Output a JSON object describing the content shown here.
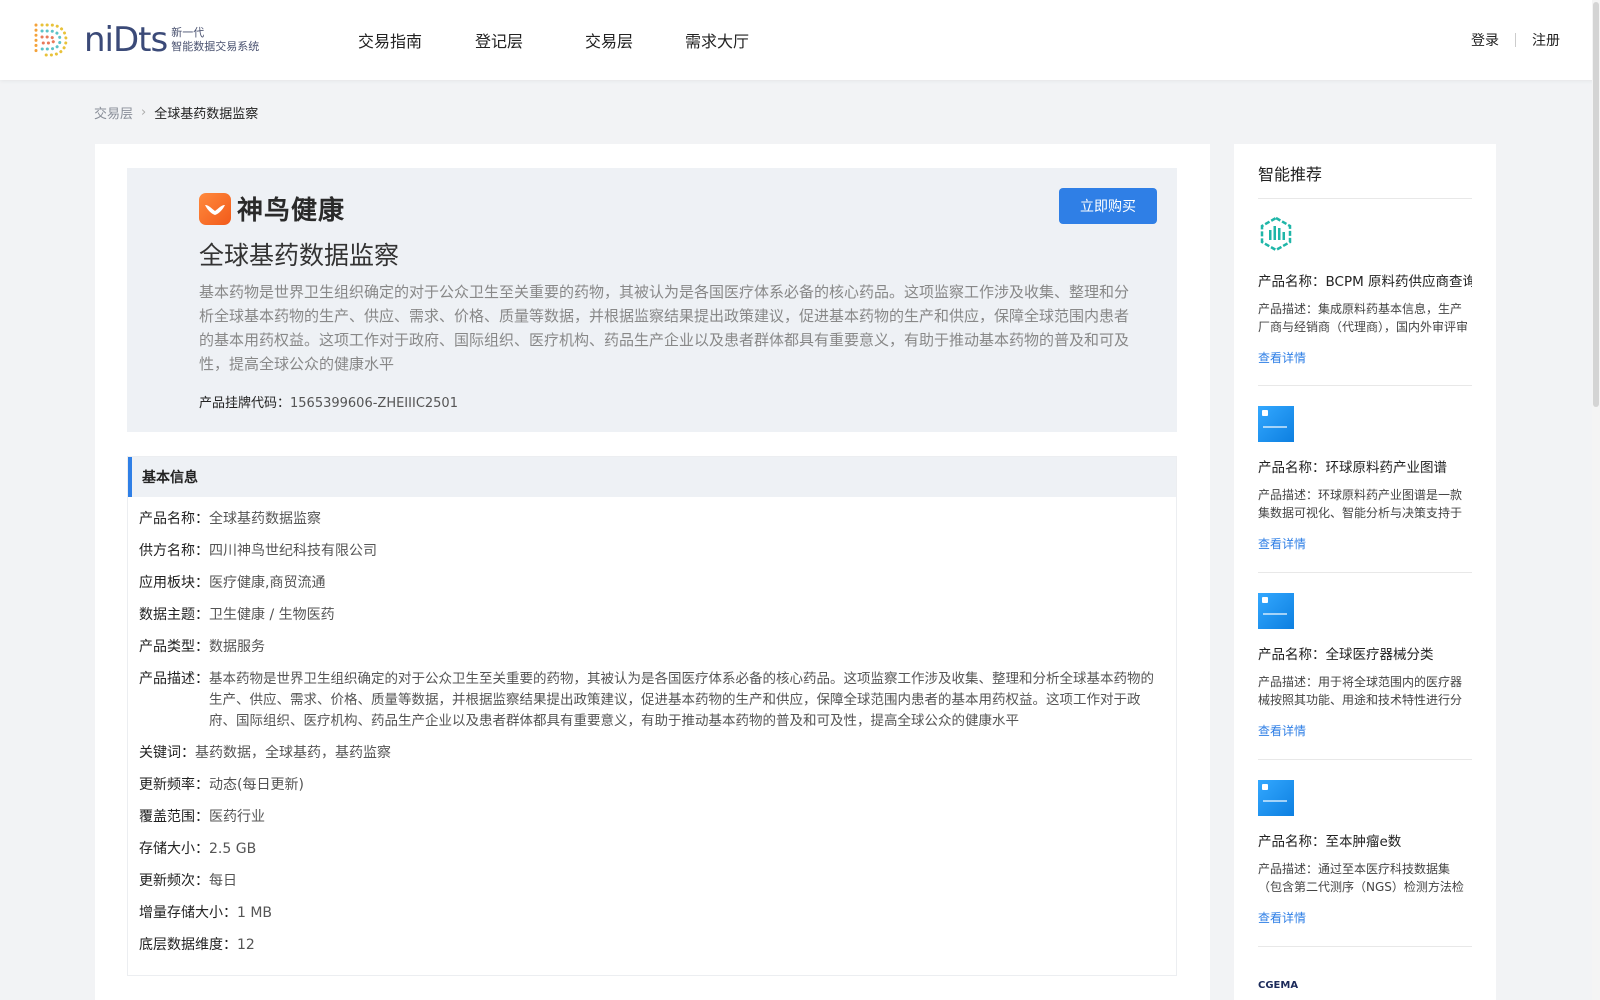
{
  "header": {
    "logo_name": "niDts",
    "logo_sub1": "新一代",
    "logo_sub2": "智能数据交易系统",
    "nav": [
      "交易指南",
      "登记层",
      "交易层",
      "需求大厅"
    ],
    "login": "登录",
    "register": "注册"
  },
  "breadcrumb": {
    "parent": "交易层",
    "sep": "›",
    "current": "全球基药数据监察"
  },
  "hero": {
    "brand": "神鸟健康",
    "buy": "立即购买",
    "title": "全球基药数据监察",
    "desc": "基本药物是世界卫生组织确定的对于公众卫生至关重要的药物，其被认为是各国医疗体系必备的核心药品。这项监察工作涉及收集、整理和分析全球基本药物的生产、供应、需求、价格、质量等数据，并根据监察结果提出政策建议，促进基本药物的生产和供应，保障全球范围内患者的基本用药权益。这项工作对于政府、国际组织、医疗机构、药品生产企业以及患者群体都具有重要意义，有助于推动基本药物的普及和可及性，提高全球公众的健康水平",
    "code_label": "产品挂牌代码：",
    "code_value": "1565399606-ZHEIIIC2501"
  },
  "basic": {
    "title": "基本信息",
    "rows": [
      {
        "k": "产品名称：",
        "v": "全球基药数据监察"
      },
      {
        "k": "供方名称：",
        "v": "四川神鸟世纪科技有限公司"
      },
      {
        "k": "应用板块：",
        "v": "医疗健康,商贸流通"
      },
      {
        "k": "数据主题：",
        "v": "卫生健康 / 生物医药"
      },
      {
        "k": "产品类型：",
        "v": "数据服务"
      },
      {
        "k": "产品描述：",
        "v": "基本药物是世界卫生组织确定的对于公众卫生至关重要的药物，其被认为是各国医疗体系必备的核心药品。这项监察工作涉及收集、整理和分析全球基本药物的生产、供应、需求、价格、质量等数据，并根据监察结果提出政策建议，促进基本药物的生产和供应，保障全球范围内患者的基本用药权益。这项工作对于政府、国际组织、医疗机构、药品生产企业以及患者群体都具有重要意义，有助于推动基本药物的普及和可及性，提高全球公众的健康水平"
      },
      {
        "k": "关键词：",
        "v": "基药数据，全球基药，基药监察"
      },
      {
        "k": "更新频率：",
        "v": "动态(每日更新)"
      },
      {
        "k": "覆盖范围：",
        "v": "医药行业"
      },
      {
        "k": "存储大小：",
        "v": "2.5 GB"
      },
      {
        "k": "更新频次：",
        "v": "每日"
      },
      {
        "k": "增量存储大小：",
        "v": "1 MB"
      },
      {
        "k": "底层数据维度：",
        "v": "12"
      }
    ]
  },
  "sidebar": {
    "title": "智能推荐",
    "link": "查看详情",
    "items": [
      {
        "name": "产品名称：BCPM 原料药供应商查询",
        "desc": "产品描述：集成原料药基本信息，生产厂商与经销商（代理商），国内外审评审批等数据"
      },
      {
        "name": "产品名称：环球原料药产业图谱",
        "desc": "产品描述：环球原料药产业图谱是一款集数据可视化、智能分析与决策支持于一体的平台"
      },
      {
        "name": "产品名称：全球医疗器械分类",
        "desc": "产品描述：用于将全球范围内的医疗器械按照其功能、用途和技术特性进行分类的体系"
      },
      {
        "name": "产品名称：至本肿瘤e数",
        "desc": "产品描述：通过至本医疗科技数据集（包含第二代测序（NGS）检测方法检测的数据）"
      }
    ],
    "last_logo": "CGEMA"
  }
}
